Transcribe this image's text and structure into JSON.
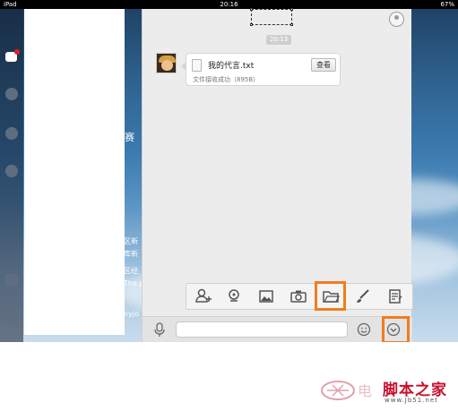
{
  "status_bar": {
    "device": "iPad",
    "time": "20:16",
    "battery": "67%"
  },
  "background_texts": {
    "t1": "赛",
    "t2": "区新",
    "t3": "库新",
    "t4": "区经",
    "t5": "The p",
    "t6": "nyjo"
  },
  "chat": {
    "timestamp": "20:13",
    "message": {
      "file_name": "我的代言.txt",
      "status": "文件接收成功（895B）",
      "view_button": "查看"
    }
  },
  "toolbar_icons": [
    "add-contact-icon",
    "location-icon",
    "image-icon",
    "camera-icon",
    "folder-icon",
    "brush-icon",
    "note-icon"
  ],
  "highlight_color": "#f27c1e",
  "watermark": {
    "brand": "脚本之家",
    "url": "www.Jb51.net"
  }
}
